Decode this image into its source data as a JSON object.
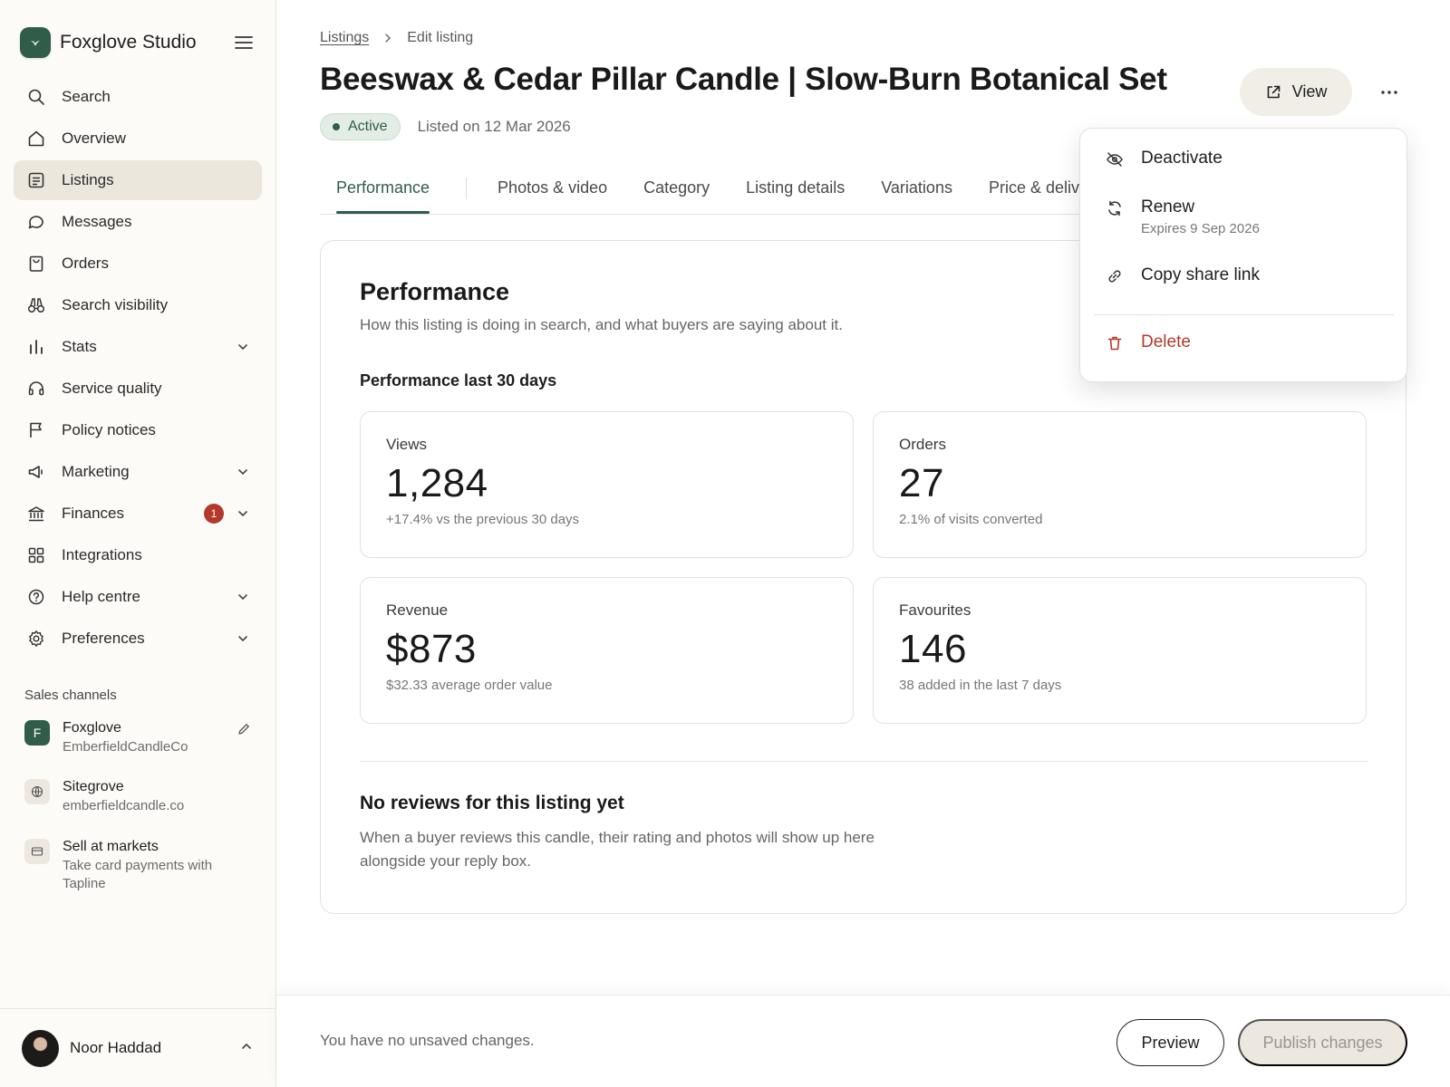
{
  "brand": {
    "name": "Foxglove Studio",
    "logo_color": "#2f5d4a"
  },
  "sidebar": {
    "items": [
      {
        "label": "Search",
        "icon": "search-icon"
      },
      {
        "label": "Overview",
        "icon": "home-icon"
      },
      {
        "label": "Listings",
        "icon": "listings-icon",
        "active": true
      },
      {
        "label": "Messages",
        "icon": "message-icon"
      },
      {
        "label": "Orders",
        "icon": "bag-icon"
      },
      {
        "label": "Search visibility",
        "icon": "binoculars-icon"
      },
      {
        "label": "Stats",
        "icon": "bar-chart-icon",
        "expandable": true
      },
      {
        "label": "Service quality",
        "icon": "headset-icon"
      },
      {
        "label": "Policy notices",
        "icon": "flag-icon"
      },
      {
        "label": "Marketing",
        "icon": "megaphone-icon",
        "expandable": true
      },
      {
        "label": "Finances",
        "icon": "bank-icon",
        "expandable": true,
        "badge": "1"
      },
      {
        "label": "Integrations",
        "icon": "grid-icon"
      },
      {
        "label": "Help centre",
        "icon": "help-icon",
        "expandable": true
      },
      {
        "label": "Preferences",
        "icon": "gear-icon",
        "expandable": true
      }
    ],
    "sales_channels_label": "Sales channels",
    "channels": [
      {
        "title": "Foxglove",
        "subtitle": "EmberfieldCandleCo",
        "icon_letter": "F"
      },
      {
        "title": "Sitegrove",
        "subtitle": "emberfieldcandle.co"
      },
      {
        "title": "Sell at markets",
        "subtitle": "Take card payments with Tapline"
      }
    ],
    "user": {
      "name": "Noor Haddad"
    }
  },
  "breadcrumb": {
    "parent": "Listings",
    "current": "Edit listing"
  },
  "listing": {
    "title": "Beeswax & Cedar Pillar Candle | Slow-Burn Botanical Set",
    "status": "Active",
    "listed_on": "Listed on 12 Mar 2026"
  },
  "header_actions": {
    "view_label": "View"
  },
  "tabs": [
    "Performance",
    "Photos & video",
    "Category",
    "Listing details",
    "Variations",
    "Price & delivery"
  ],
  "performance": {
    "title": "Performance",
    "subtitle": "How this listing is doing in search, and what buyers are saying about it.",
    "period_label": "Performance last 30 days",
    "metrics": [
      {
        "label": "Views",
        "value": "1,284",
        "note": "+17.4% vs the previous 30 days"
      },
      {
        "label": "Orders",
        "value": "27",
        "note": "2.1% of visits converted"
      },
      {
        "label": "Revenue",
        "value": "$873",
        "note": "$32.33 average order value"
      },
      {
        "label": "Favourites",
        "value": "146",
        "note": "38 added in the last 7 days"
      }
    ],
    "reviews_title": "No reviews for this listing yet",
    "reviews_text": "When a buyer reviews this candle, their rating and photos will show up here alongside your reply box."
  },
  "footer": {
    "status_text": "You have no unsaved changes.",
    "preview_label": "Preview",
    "publish_label": "Publish changes"
  },
  "menu": {
    "deactivate": "Deactivate",
    "renew": "Renew",
    "renew_sub": "Expires 9 Sep 2026",
    "copy_link": "Copy share link",
    "delete": "Delete"
  },
  "colors": {
    "accent": "#2f5d4a",
    "danger": "#b33a2a",
    "active_nav_bg": "#ece7dd"
  }
}
